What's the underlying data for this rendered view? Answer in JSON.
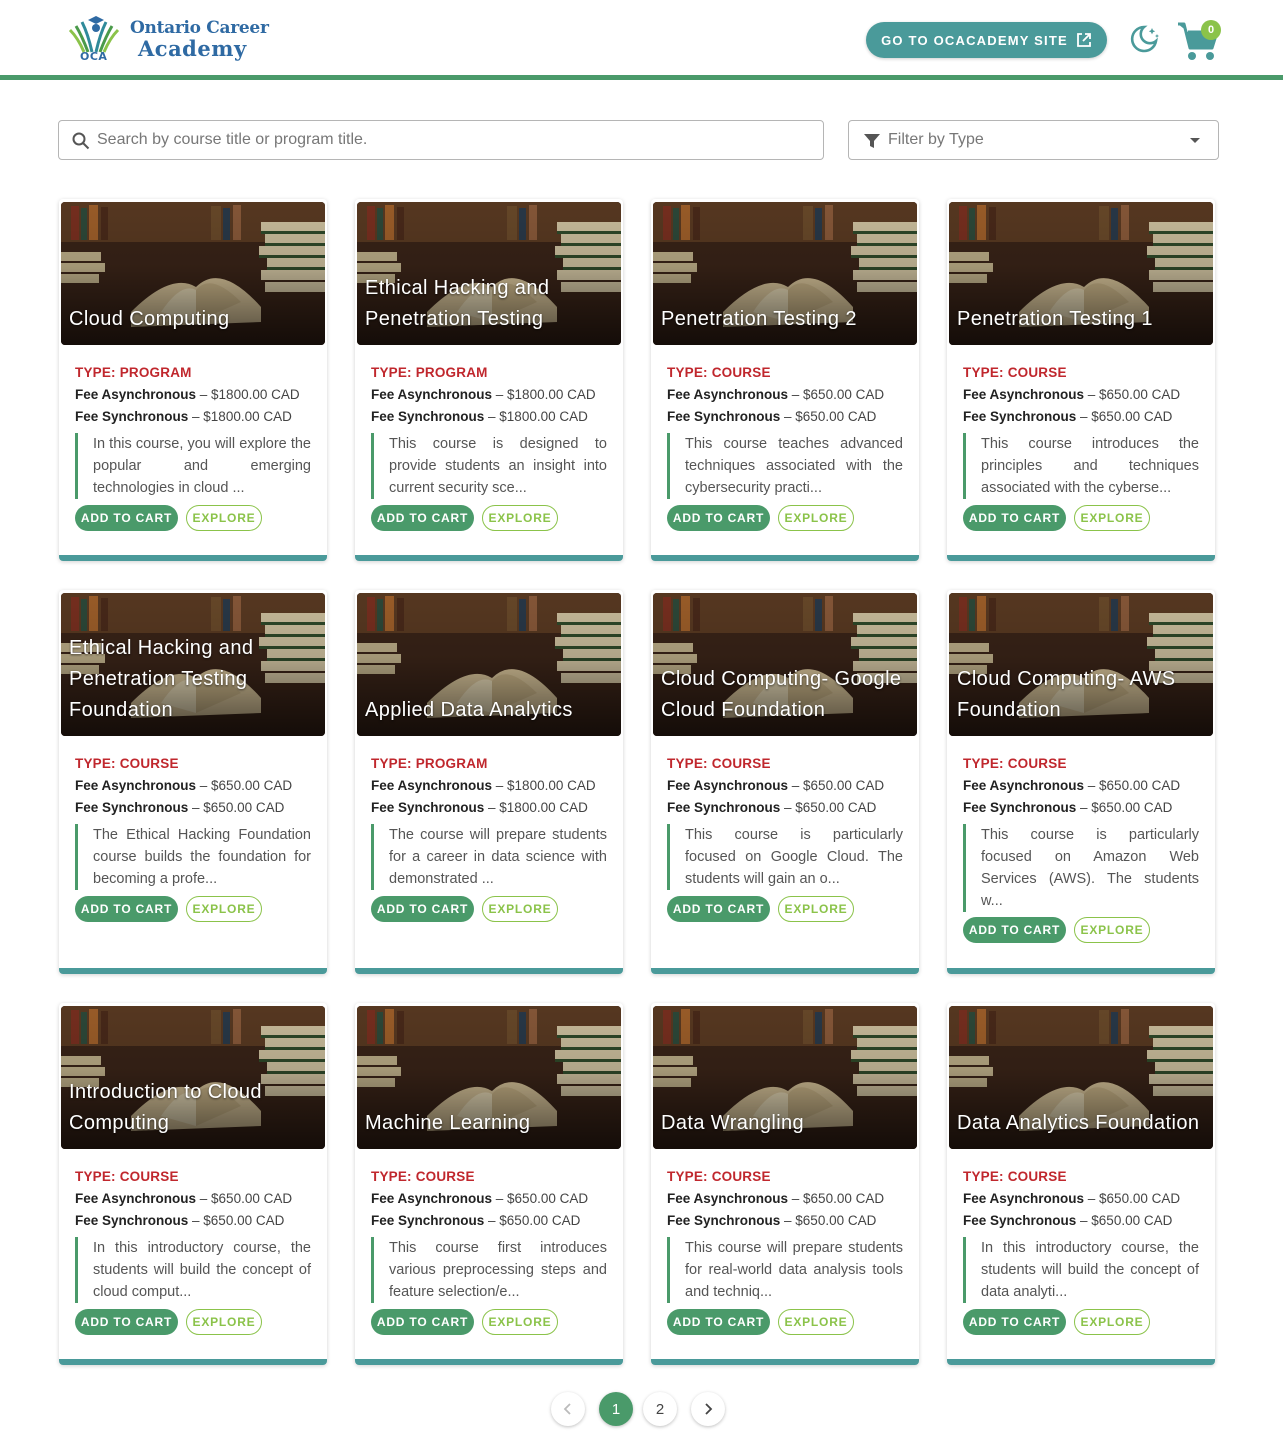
{
  "header": {
    "logo_line1": "Ontario Career",
    "logo_line2": "Academy",
    "logo_abbr": "OCA",
    "site_button_label": "GO TO OCACADEMY SITE",
    "cart_count": "0"
  },
  "search": {
    "placeholder": "Search by course title or program title.",
    "value": ""
  },
  "filter": {
    "placeholder": "Filter by Type"
  },
  "card_labels": {
    "fee_async": "Fee Asynchronous",
    "fee_sync": "Fee Synchronous",
    "add_to_cart": "ADD TO CART",
    "explore": "EXPLORE"
  },
  "courses": [
    {
      "title": "Cloud Computing",
      "type": "TYPE: PROGRAM",
      "fee_async": " – $1800.00 CAD",
      "fee_sync": " – $1800.00 CAD",
      "description": "In this course, you will explore the popular and emerging technologies in cloud ..."
    },
    {
      "title": "Ethical Hacking and Penetration Testing",
      "type": "TYPE: PROGRAM",
      "fee_async": " – $1800.00 CAD",
      "fee_sync": " – $1800.00 CAD",
      "description": "This course is designed to provide students an insight into current security sce..."
    },
    {
      "title": "Penetration Testing 2",
      "type": "TYPE: COURSE",
      "fee_async": " – $650.00 CAD",
      "fee_sync": " – $650.00 CAD",
      "description": "This course teaches advanced techniques associated with the cybersecurity practi..."
    },
    {
      "title": "Penetration Testing 1",
      "type": "TYPE: COURSE",
      "fee_async": " – $650.00 CAD",
      "fee_sync": " – $650.00 CAD",
      "description": "This course introduces the principles and techniques associated with the cyberse..."
    },
    {
      "title": "Ethical Hacking and Penetration Testing Foundation",
      "type": "TYPE: COURSE",
      "fee_async": " – $650.00 CAD",
      "fee_sync": " – $650.00 CAD",
      "description": "The Ethical Hacking Foundation course builds the foundation for becoming a profe..."
    },
    {
      "title": "Applied Data Analytics",
      "type": "TYPE: PROGRAM",
      "fee_async": " – $1800.00 CAD",
      "fee_sync": " – $1800.00 CAD",
      "description": "The course will prepare students for a career in data science with demonstrated ..."
    },
    {
      "title": "Cloud Computing- Google Cloud Foundation",
      "type": "TYPE: COURSE",
      "fee_async": " – $650.00 CAD",
      "fee_sync": " – $650.00 CAD",
      "description": "This course is particularly focused on Google Cloud. The students will gain an o..."
    },
    {
      "title": "Cloud Computing- AWS Foundation",
      "type": "TYPE: COURSE",
      "fee_async": " – $650.00 CAD",
      "fee_sync": " – $650.00 CAD",
      "description": "This course is particularly focused on Amazon Web Services (AWS). The students w..."
    },
    {
      "title": "Introduction to Cloud Computing",
      "type": "TYPE: COURSE",
      "fee_async": " – $650.00 CAD",
      "fee_sync": " – $650.00 CAD",
      "description": "In this introductory course, the students will build the concept of cloud comput..."
    },
    {
      "title": "Machine Learning",
      "type": "TYPE: COURSE",
      "fee_async": " – $650.00 CAD",
      "fee_sync": " – $650.00 CAD",
      "description": "This course first introduces various preprocessing steps and feature selection/e..."
    },
    {
      "title": "Data Wrangling",
      "type": "TYPE: COURSE",
      "fee_async": " – $650.00 CAD",
      "fee_sync": " – $650.00 CAD",
      "description": "This course will prepare students for real-world data analysis tools and techniq..."
    },
    {
      "title": "Data Analytics Foundation",
      "type": "TYPE: COURSE",
      "fee_async": " – $650.00 CAD",
      "fee_sync": " – $650.00 CAD",
      "description": "In this introductory course, the students will build the concept of data analyti..."
    }
  ],
  "pagination": {
    "pages": [
      "1",
      "2"
    ],
    "current": "1"
  }
}
